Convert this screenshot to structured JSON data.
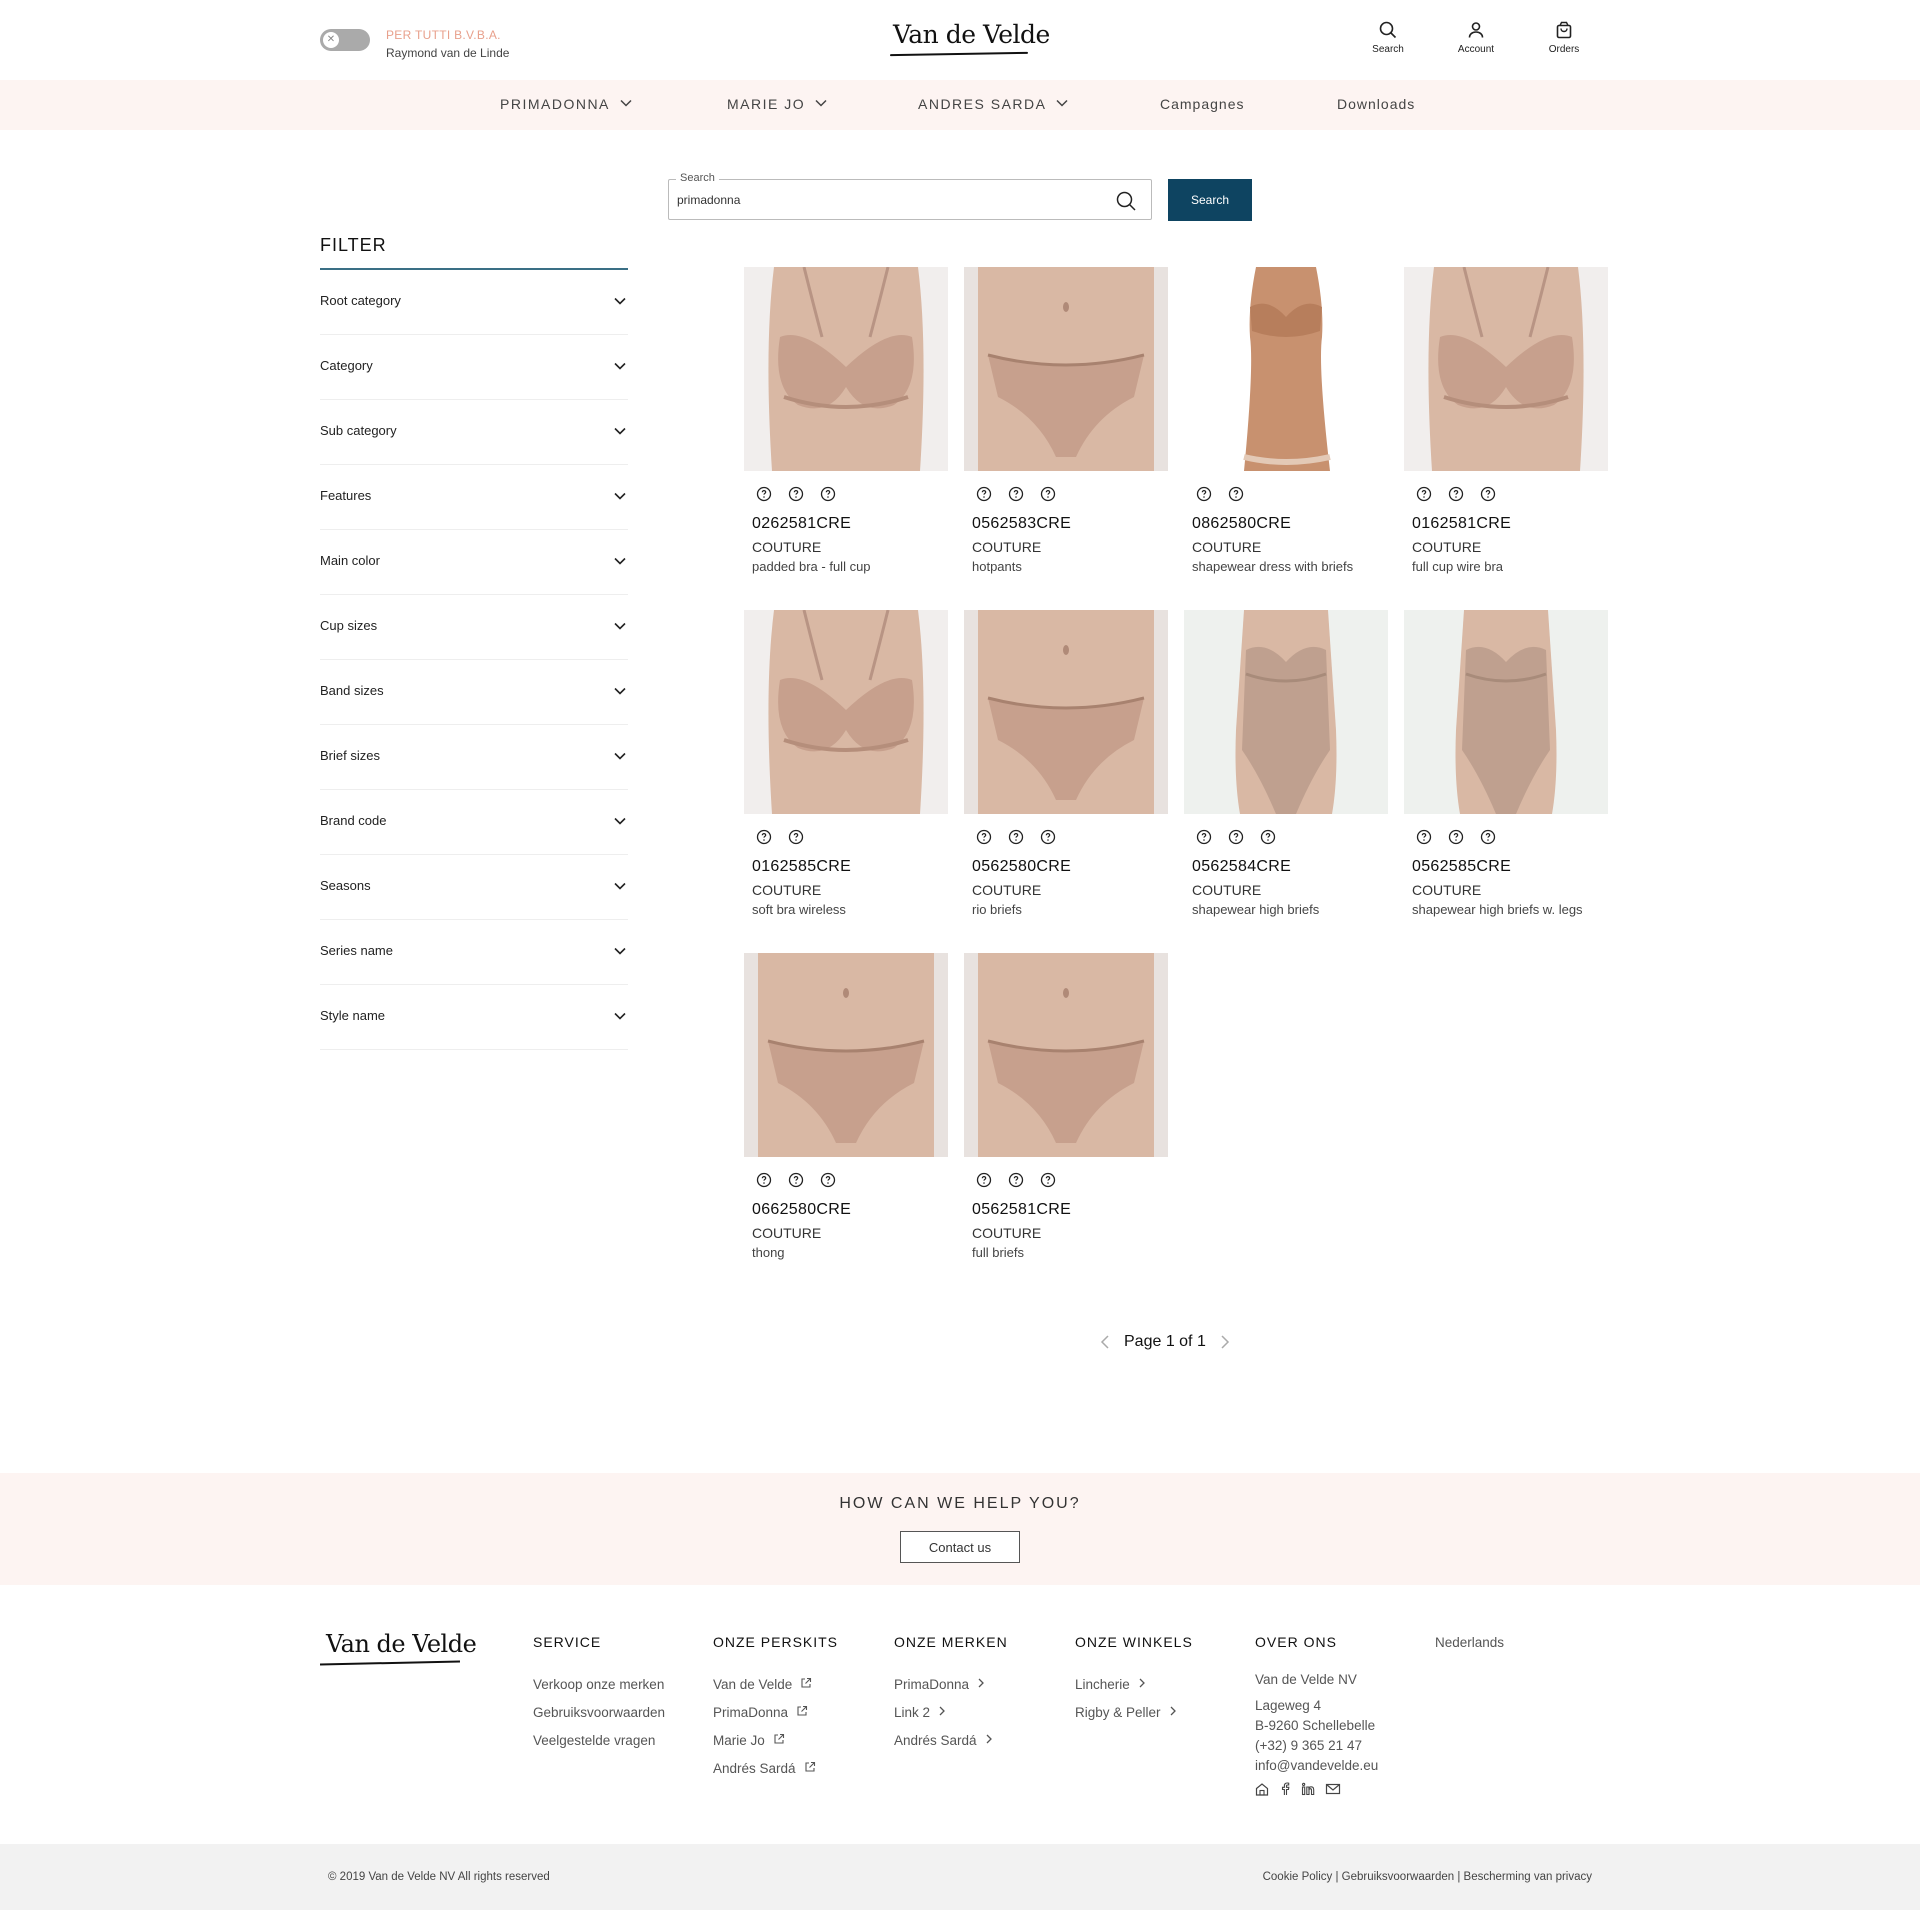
{
  "header": {
    "company": "PER TUTTI B.V.B.A.",
    "user": "Raymond van de Linde",
    "logo": "Van de Velde",
    "tools": [
      {
        "label": "Search",
        "icon": "search-icon"
      },
      {
        "label": "Account",
        "icon": "user-icon"
      },
      {
        "label": "Orders",
        "icon": "bag-icon"
      }
    ]
  },
  "nav": {
    "items": [
      {
        "label": "PRIMADONNA",
        "has_dropdown": true
      },
      {
        "label": "MARIE JO",
        "has_dropdown": true
      },
      {
        "label": "ANDRES SARDA",
        "has_dropdown": true
      },
      {
        "label": "Campagnes",
        "has_dropdown": false
      },
      {
        "label": "Downloads",
        "has_dropdown": false
      }
    ]
  },
  "search": {
    "label": "Search",
    "value": "primadonna",
    "button": "Search"
  },
  "filter": {
    "title": "FILTER",
    "items": [
      "Root category",
      "Category",
      "Sub category",
      "Features",
      "Main color",
      "Cup sizes",
      "Band sizes",
      "Brief sizes",
      "Brand code",
      "Seasons",
      "Series name",
      "Style name"
    ]
  },
  "products": [
    {
      "sku": "0262581CRE",
      "line": "COUTURE",
      "desc": "padded bra - full cup",
      "icons": 3,
      "type": "bra"
    },
    {
      "sku": "0562583CRE",
      "line": "COUTURE",
      "desc": "hotpants",
      "icons": 3,
      "type": "brief"
    },
    {
      "sku": "0862580CRE",
      "line": "COUTURE",
      "desc": "shapewear dress with briefs",
      "icons": 2,
      "type": "dress"
    },
    {
      "sku": "0162581CRE",
      "line": "COUTURE",
      "desc": "full cup wire bra",
      "icons": 3,
      "type": "bra"
    },
    {
      "sku": "0162585CRE",
      "line": "COUTURE",
      "desc": "soft bra wireless",
      "icons": 2,
      "type": "bra"
    },
    {
      "sku": "0562580CRE",
      "line": "COUTURE",
      "desc": "rio briefs",
      "icons": 3,
      "type": "brief"
    },
    {
      "sku": "0562584CRE",
      "line": "COUTURE",
      "desc": "shapewear high briefs",
      "icons": 3,
      "type": "body"
    },
    {
      "sku": "0562585CRE",
      "line": "COUTURE",
      "desc": "shapewear high briefs w. legs",
      "icons": 3,
      "type": "body"
    },
    {
      "sku": "0662580CRE",
      "line": "COUTURE",
      "desc": "thong",
      "icons": 3,
      "type": "brief"
    },
    {
      "sku": "0562581CRE",
      "line": "COUTURE",
      "desc": "full briefs",
      "icons": 3,
      "type": "brief"
    }
  ],
  "pager": {
    "text": "Page 1 of 1"
  },
  "help": {
    "title": "HOW CAN WE HELP YOU?",
    "button": "Contact us"
  },
  "footer": {
    "logo": "Van de Velde",
    "columns": [
      {
        "title": "SERVICE",
        "links": [
          {
            "label": "Verkoop onze merken",
            "icon": ""
          },
          {
            "label": "Gebruiksvoorwaarden",
            "icon": ""
          },
          {
            "label": "Veelgestelde vragen",
            "icon": ""
          }
        ]
      },
      {
        "title": "ONZE PERSKITS",
        "links": [
          {
            "label": "Van de Velde",
            "icon": "external"
          },
          {
            "label": "PrimaDonna",
            "icon": "external"
          },
          {
            "label": "Marie Jo",
            "icon": "external"
          },
          {
            "label": "Andrés Sardá",
            "icon": "external"
          }
        ]
      },
      {
        "title": "ONZE MERKEN",
        "links": [
          {
            "label": "PrimaDonna",
            "icon": "chevron"
          },
          {
            "label": "Link 2",
            "icon": "chevron"
          },
          {
            "label": "Andrés Sardá",
            "icon": "chevron"
          }
        ]
      },
      {
        "title": "ONZE WINKELS",
        "links": [
          {
            "label": "Lincherie",
            "icon": "chevron"
          },
          {
            "label": "Rigby & Peller",
            "icon": "chevron"
          }
        ]
      }
    ],
    "about": {
      "title": "OVER ONS",
      "company": "Van de Velde NV",
      "street": "Lageweg 4",
      "city": "B-9260 Schellebelle",
      "phone": "(+32) 9 365 21 47",
      "email": "info@vandevelde.eu",
      "social": [
        "home-icon",
        "facebook-icon",
        "linkedin-icon",
        "mail-icon"
      ]
    },
    "language": "Nederlands",
    "copyright": "© 2019 Van de Velde NV All rights reserved",
    "legal": "Cookie Policy | Gebruiksvoorwaarden | Bescherming van privacy"
  },
  "colors": {
    "accent": "#0e4461",
    "blush": "#fdf4f2",
    "skin": "#d9b8a4",
    "garment": "#c7a08d"
  }
}
